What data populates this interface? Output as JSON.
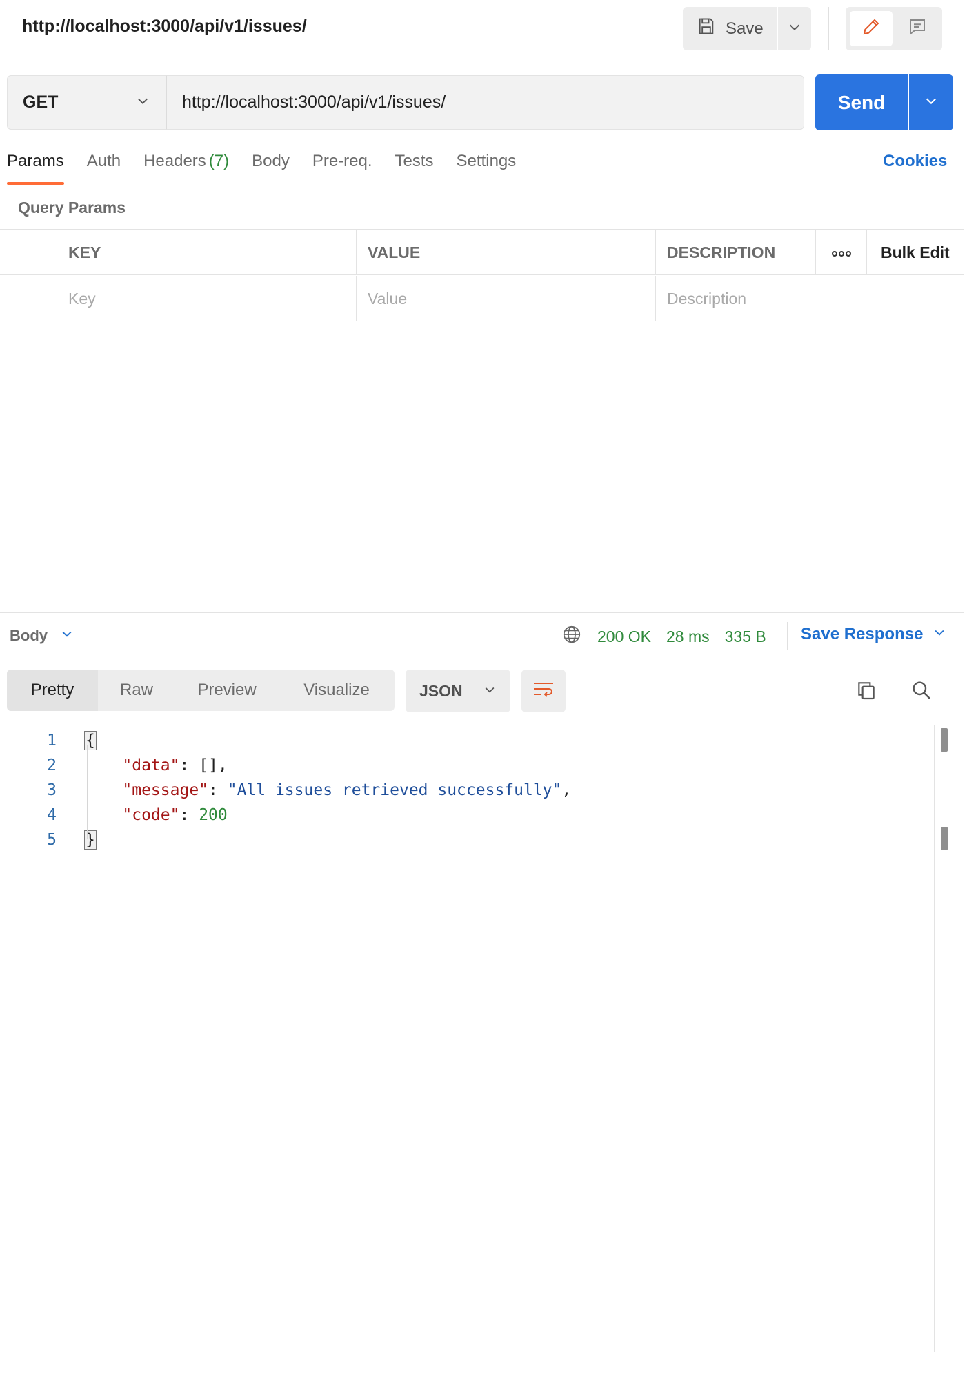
{
  "header": {
    "title": "http://localhost:3000/api/v1/issues/",
    "save_label": "Save"
  },
  "request": {
    "method": "GET",
    "url": "http://localhost:3000/api/v1/issues/",
    "send_label": "Send"
  },
  "tabs": [
    {
      "label": "Params",
      "active": true
    },
    {
      "label": "Auth"
    },
    {
      "label": "Headers",
      "count": "(7)"
    },
    {
      "label": "Body"
    },
    {
      "label": "Pre-req."
    },
    {
      "label": "Tests"
    },
    {
      "label": "Settings"
    }
  ],
  "cookies_label": "Cookies",
  "query_params": {
    "title": "Query Params",
    "columns": [
      "KEY",
      "VALUE",
      "DESCRIPTION"
    ],
    "more_label": "ooo",
    "bulk_edit_label": "Bulk Edit",
    "placeholders": {
      "key": "Key",
      "value": "Value",
      "description": "Description"
    }
  },
  "response": {
    "body_label": "Body",
    "status": "200 OK",
    "time": "28 ms",
    "size": "335 B",
    "save_response_label": "Save Response",
    "views": [
      "Pretty",
      "Raw",
      "Preview",
      "Visualize"
    ],
    "format": "JSON",
    "line_numbers": [
      "1",
      "2",
      "3",
      "4",
      "5"
    ],
    "json": {
      "open": "{",
      "data_key": "\"data\"",
      "data_value": "[]",
      "message_key": "\"message\"",
      "message_value": "\"All issues retrieved successfully\"",
      "code_key": "\"code\"",
      "code_value": "200",
      "close": "}"
    }
  },
  "colors": {
    "accent": "#ff6c37",
    "primary": "#2a74e0",
    "status_ok": "#2f8a3b",
    "link": "#1f6fcf"
  },
  "icons": [
    "save-icon",
    "chevron-down-icon",
    "pencil-icon",
    "comment-icon",
    "globe-icon",
    "wrap-lines-icon",
    "copy-icon",
    "search-icon"
  ]
}
